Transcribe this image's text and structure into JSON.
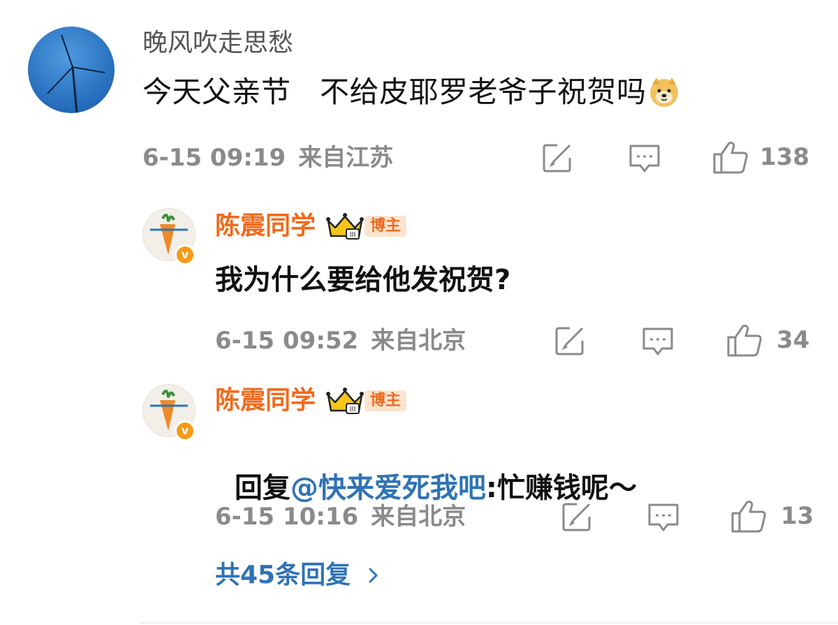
{
  "comment": {
    "username": "晚风吹走思愁",
    "text": "今天父亲节   不给皮耶罗老爷子祝贺吗",
    "emoji_icon": "doge-icon",
    "time": "6-15 09:19",
    "location": "来自江苏",
    "likes": "138"
  },
  "replies": [
    {
      "username": "陈震同学",
      "badge": "博主",
      "crown_level": "III",
      "text": "我为什么要给他发祝贺?",
      "time": "6-15 09:52",
      "location": "来自北京",
      "likes": "34"
    },
    {
      "username": "陈震同学",
      "badge": "博主",
      "crown_level": "III",
      "text_prefix": "回复",
      "mention": "@快来爱死我吧",
      "text_suffix": ":忙赚钱呢～",
      "time": "6-15 10:16",
      "location": "来自北京",
      "likes": "13"
    }
  ],
  "more_replies": "共45条回复",
  "colors": {
    "username_orange": "#f06a1c",
    "mention_blue": "#2f73b5",
    "meta_gray": "#8a8a8a"
  }
}
